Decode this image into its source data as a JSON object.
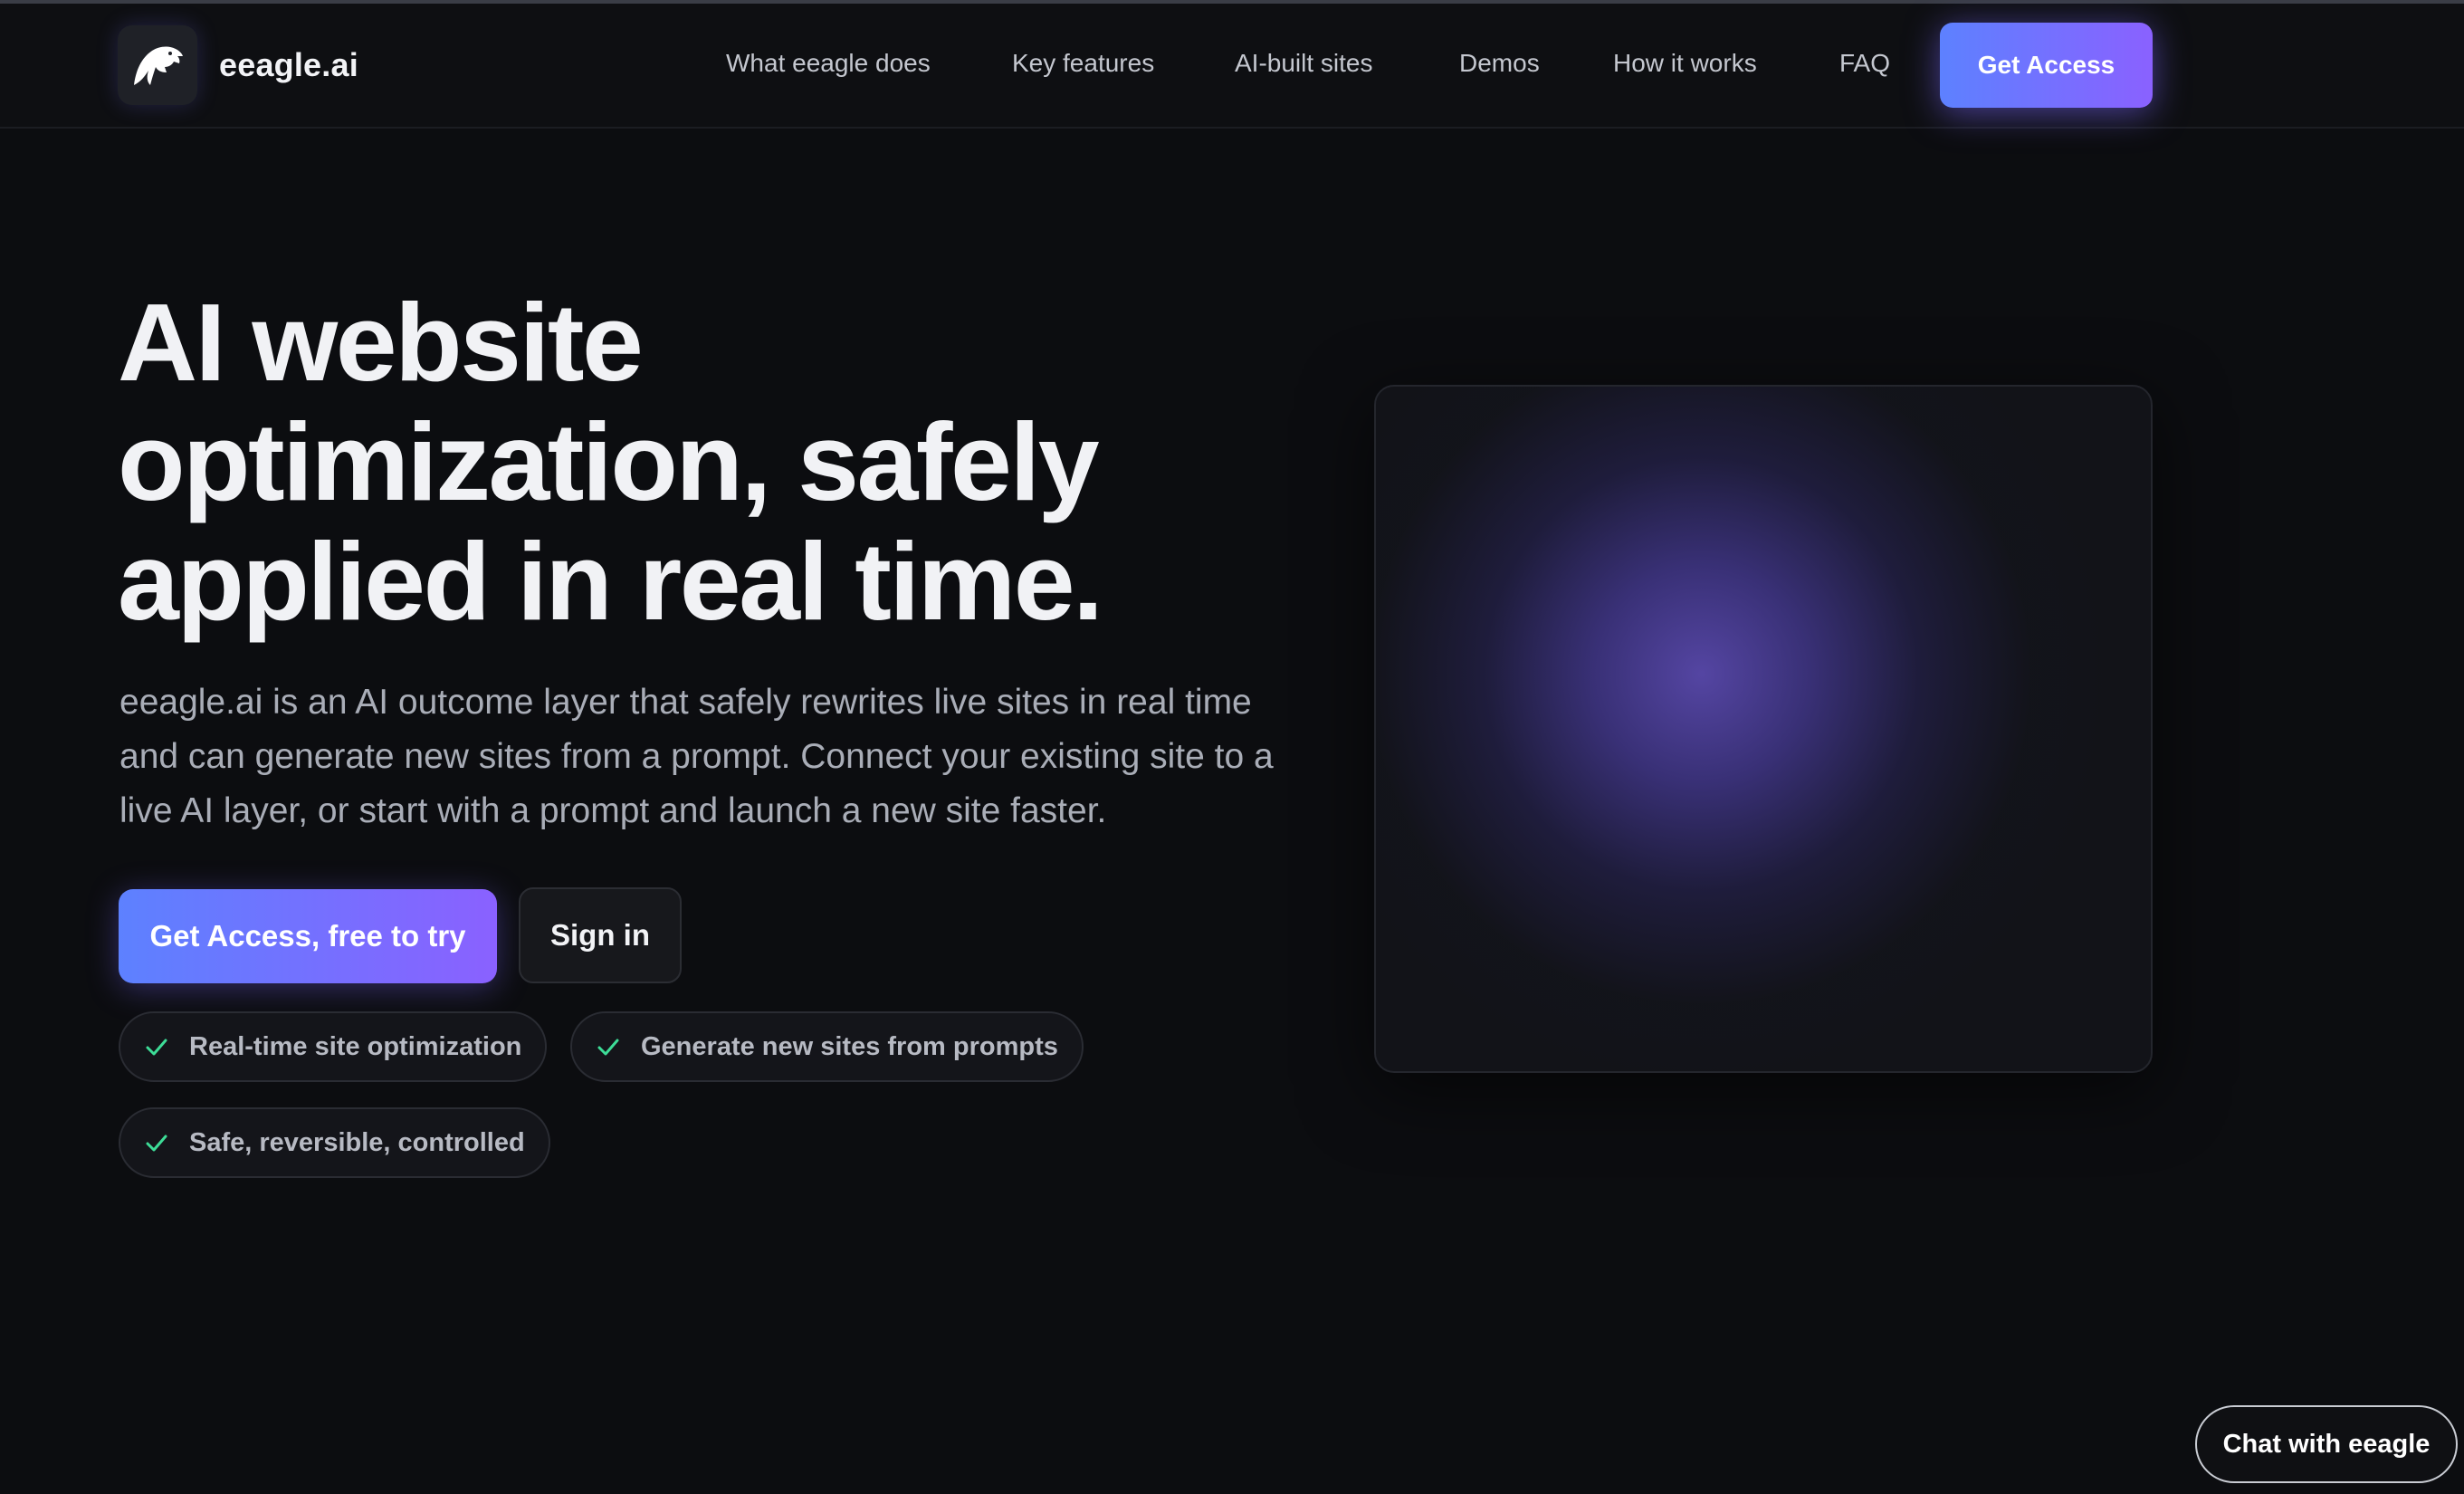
{
  "brand": {
    "name": "eeagle.ai",
    "logo_icon": "eagle-head-icon"
  },
  "nav": {
    "links": [
      "What eeagle does",
      "Key features",
      "AI-built sites",
      "Demos",
      "How it works",
      "FAQ"
    ],
    "cta_label": "Get Access"
  },
  "hero": {
    "title_lines": [
      "AI website",
      "optimization, safely",
      "applied in real time."
    ],
    "description": "eeagle.ai is an AI outcome layer that safely rewrites live sites in real time and can generate new sites from a prompt. Connect your existing site to a live AI layer, or start with a prompt and launch a new site faster.",
    "primary_button": "Get Access, free to try",
    "secondary_button": "Sign in",
    "badges": [
      "Real-time site optimization",
      "Generate new sites from prompts",
      "Safe, reversible, controlled"
    ],
    "badge_icon": "check-icon"
  },
  "chat": {
    "label": "Chat with eeagle"
  },
  "colors": {
    "background": "#0c0d10",
    "accent_start": "#5d81ff",
    "accent_end": "#8a61ff",
    "check": "#3ddc97"
  }
}
